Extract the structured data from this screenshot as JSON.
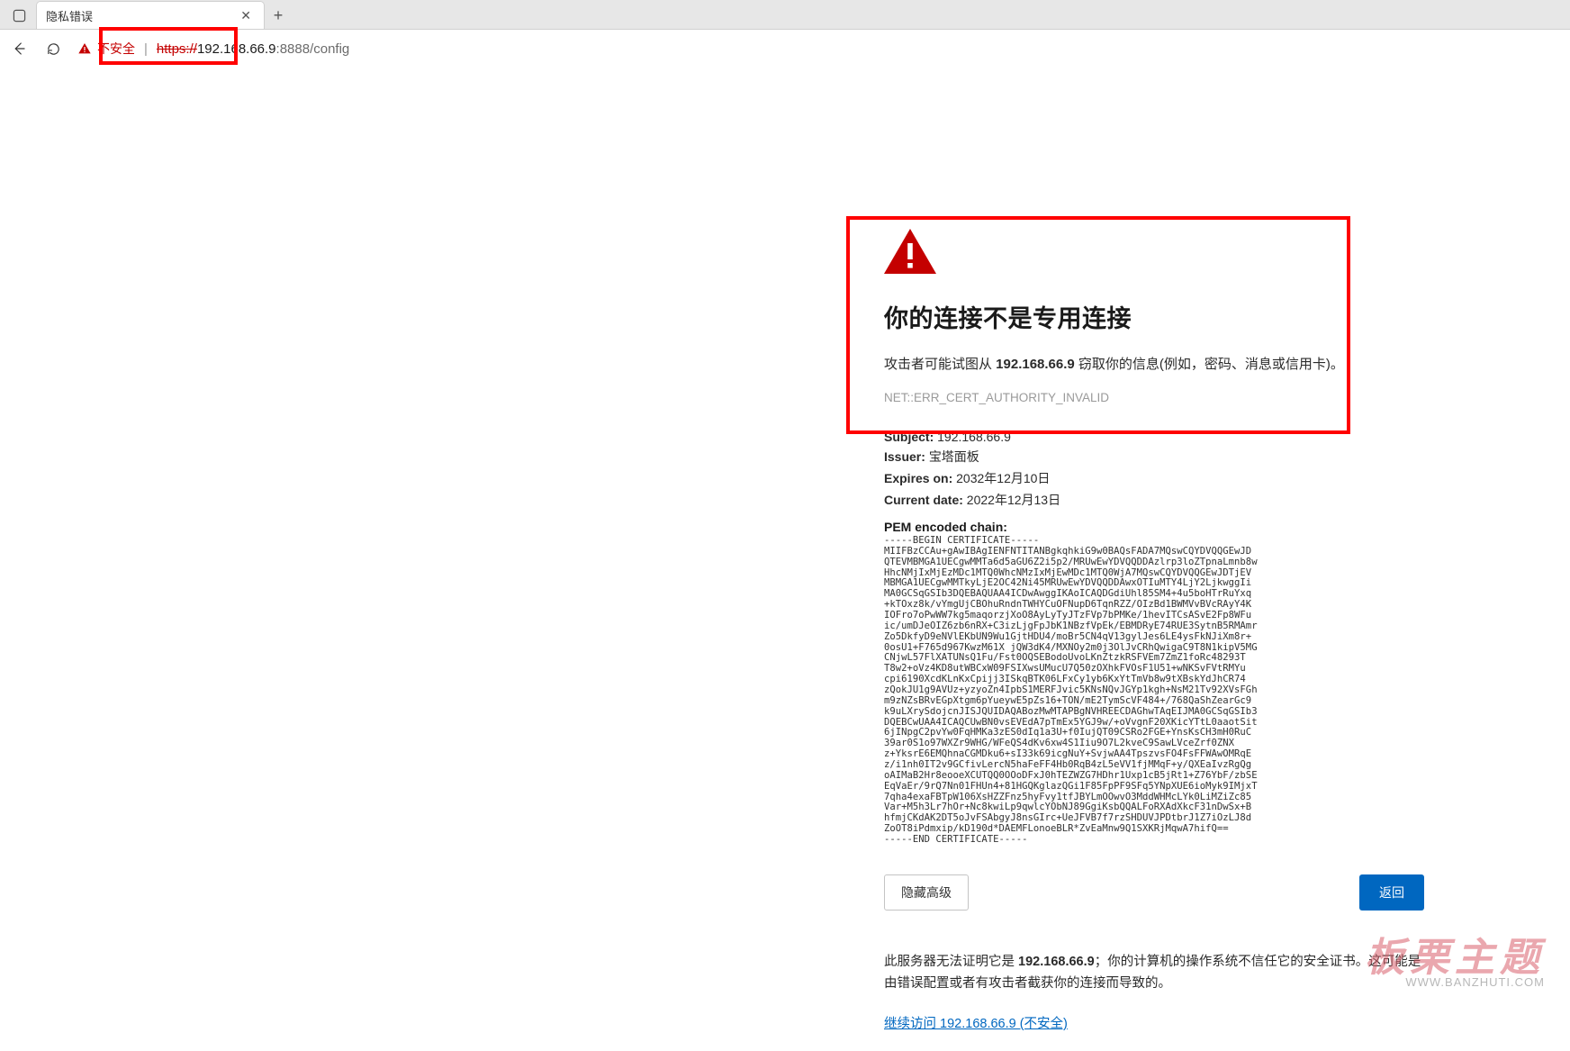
{
  "tab": {
    "title": "隐私错误",
    "close_glyph": "✕"
  },
  "toolbar": {
    "back_glyph": "←",
    "reload_glyph": "⟳",
    "new_tab_glyph": "+",
    "panel_glyph": "▢"
  },
  "address": {
    "insecure_label": "不安全",
    "scheme": "https://",
    "host": "192.168.66.9",
    "port_path": ":8888/config"
  },
  "interstitial": {
    "heading": "你的连接不是专用连接",
    "subtext_prefix": "攻击者可能试图从 ",
    "subtext_host": "192.168.66.9",
    "subtext_suffix": " 窃取你的信息(例如，密码、消息或信用卡)。",
    "error_code": "NET::ERR_CERT_AUTHORITY_INVALID",
    "fields": {
      "subject_label": "Subject:",
      "subject_value": "192.168.66.9",
      "issuer_label": "Issuer:",
      "issuer_value": "宝塔面板",
      "expires_label": "Expires on:",
      "expires_value": "2032年12月10日",
      "current_label": "Current date:",
      "current_value": "2022年12月13日",
      "pem_label": "PEM encoded chain:"
    },
    "pem": "-----BEGIN CERTIFICATE-----\nMIIFBzCCAu+gAwIBAgIENFNTITANBgkqhkiG9w0BAQsFADA7MQswCQYDVQQGEwJD\nQTEVMBMGA1UECgwMMTa6d5aGU6Z2i5p2/MRUwEwYDVQQDDAzlrp3loZTpnaLmnb8w\nHhcNMjIxMjEzMDc1MTQ0WhcNMzIxMjEwMDc1MTQ0WjA7MQswCQYDVQQGEwJDTjEV\nMBMGA1UECgwMMTkyLjE2OC42Ni45MRUwEwYDVQQDDAwxOTIuMTY4LjY2LjkwggIi\nMA0GCSqGSIb3DQEBAQUAA4ICDwAwggIKAoICAQDGdiUhl85SM4+4u5boHTrRuYxq\n+kTOxz8k/vYmgUjCBOhuRndnTWHYCuOFNupD6TqnRZZ/OIzBd1BWMVvBVcRAyY4K\nIOFro7oPwWW7kg5maqorzjXoO8AyLyTyJTzFVp7bPMKe/1hevITCsASvE2Fp8WFu\nic/umDJeOIZ6zb6nRX+C3izLjgFpJbK1NBzfVpEk/EBMDRyE74RUE3SytnB5RMAmr\nZo5DkfyD9eNVlEKbUN9Wu1GjtHDU4/moBr5CN4qV13gylJes6LE4ysFkNJiXm8r+\n0osU1+F765d967KwzM61X jQW3dK4/MXNOy2m0j3OlJvCRhQwigaC9T8N1kipV5MG\nCNjwL57FlXATUNsQ1Fu/Fst0OQSEBodoUvoLKnZtzkRSFVEm7ZmZ1foRc48293T\nT8w2+oVz4KD8utWBCxW09FSIXwsUMucU7Q50zOXhkFVOsF1U51+wNKSvFVtRMYu\ncpi6190XcdKLnKxCpijj3ISkqBTK06LFxCy1yb6KxYtTmVb8w9tXBskYdJhCR74\nzQokJU1g9AVUz+yzyoZn4IpbS1MERFJvic5KNsNQvJGYp1kgh+NsM21Tv92XVsFGh\nm9zNZsBRvEGpXtgm6pYueywE5pZs16+TON/mE2TymScVF484+/768QaShZearGc9\nk9uLXrySdojcnJISJQUIDAQABozMwMTAPBgNVHREECDAGhwTAqEIJMA0GCSqGSIb3\nDQEBCwUAA4ICAQCUwBN0vsEVEdA7pTmEx5YGJ9w/+oVvgnF20XKicYTtL0aaotSit\n6jINpgC2pvYw0FqHMKa3zES0dIq1a3U+f0IujQT09CSRo2FGE+YnsKsCH3mH0RuC\n39ar0S1o97WXZr9WHG/WFeQS4dKv6xw4S1Iiu9O7L2kveC9SawLVceZrf0ZNX\nz+YksrE6EMQhnaCGMDku6+sI33k69icgNuY+SvjwAA4TpszvsFO4FsFFWAwOMRqE\nz/i1nh0IT2v9GCfivLercN5haFeFF4Hb0RqB4zL5eVV1fjMMqF+y/QXEaIvzRgQg\noAIMaB2Hr8eooeXCUTQQ0OOoDFxJ0hTEZWZG7HDhr1Uxp1cB5jRt1+Z76YbF/zbSE\nEqVaEr/9rQ7Nn01FHUn4+81HGQKglazQGi1F85FpPF9SFq5YNpXUE6ioMyk9IMjxT\n7qha4exaFBTpW106XsHZZFnz5hyFvy1tfJBYLmOOwvO3MddWHMcLYk0LiMZiZc85\nVar+M5h3Lr7hOr+Nc8kwiLp9qwlcYObNJ89GgiKsbQQALFoRXAdXkcF31nDwSx+B\nhfmjCKdAK2DT5oJvFSAbgyJ8nsGIrc+UeJFVB7f7rzSHDUVJPDtbrJ1Z7iOzLJ8d\nZoOT8iPdmxip/kD190d*DAEMFLonoeBLR*ZvEaMnw9Q1SXKRjMqwA7hifQ==\n-----END CERTIFICATE-----",
    "buttons": {
      "hide_advanced": "隐藏高级",
      "back_safe": "返回"
    },
    "explain_prefix": "此服务器无法证明它是 ",
    "explain_host": "192.168.66.9",
    "explain_suffix": "；你的计算机的操作系统不信任它的安全证书。这可能是由错误配置或者有攻击者截获你的连接而导致的。",
    "proceed_link": "继续访问 192.168.66.9 (不安全)"
  },
  "watermark": {
    "cn": "板栗主题",
    "url": "WWW.BANZHUTI.COM"
  }
}
